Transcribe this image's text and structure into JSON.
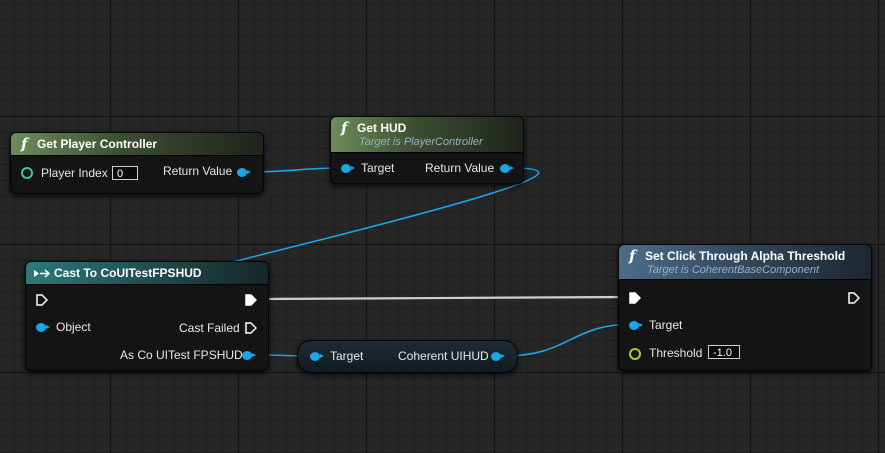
{
  "colors": {
    "exec_wire": "#cfcfcf",
    "object_wire": "#1aa6e8",
    "function_header": "#6c8c5a",
    "cast_header": "#2c7a7c",
    "component_header": "#4c6d8a"
  },
  "nodes": {
    "get_player_controller": {
      "icon": "function-icon",
      "title": "Get Player Controller",
      "pins": {
        "player_index": "Player Index",
        "player_index_value": "0",
        "return_value": "Return Value"
      }
    },
    "get_hud": {
      "icon": "function-icon",
      "title": "Get HUD",
      "subtitle": "Target is PlayerController",
      "pins": {
        "target": "Target",
        "return_value": "Return Value"
      }
    },
    "cast": {
      "icon": "cast-icon",
      "title": "Cast To CoUITestFPSHUD",
      "pins": {
        "object": "Object",
        "cast_failed": "Cast Failed",
        "as": "As Co UITest FPSHUD"
      }
    },
    "variable_get": {
      "pins": {
        "target": "Target",
        "output": "Coherent UIHUD"
      }
    },
    "set_threshold": {
      "icon": "function-icon",
      "title": "Set Click Through Alpha Threshold",
      "subtitle": "Target is CoherentBaseComponent",
      "pins": {
        "target": "Target",
        "threshold": "Threshold",
        "threshold_value": "-1.0"
      }
    }
  }
}
